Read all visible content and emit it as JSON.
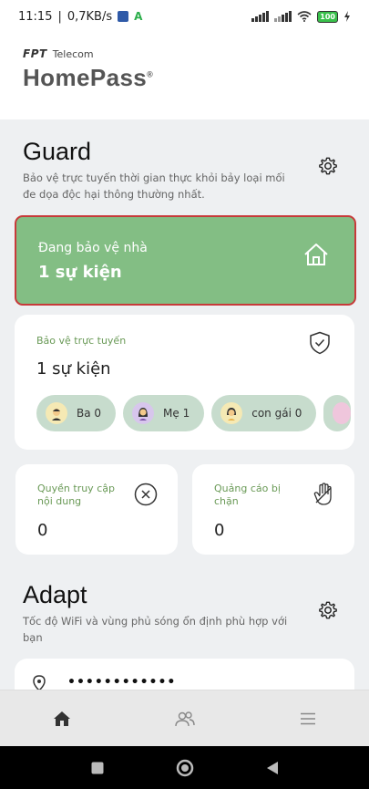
{
  "statusbar": {
    "time": "11:15",
    "speed": "0,7KB/s",
    "battery": "100"
  },
  "header": {
    "brand": "FPT",
    "brand_sub": "Telecom",
    "app_title": "HomePass",
    "trademark": "®"
  },
  "guard": {
    "title": "Guard",
    "description": "Bảo vệ trực tuyến thời gian thực khỏi bảy loại mối đe dọa độc hại thông thường nhất.",
    "protect_label": "Đang bảo vệ nhà",
    "protect_count": "1 sự kiện",
    "online_label": "Bảo vệ trực tuyến",
    "online_count": "1 sự kiện",
    "people": [
      {
        "name": "Ba 0"
      },
      {
        "name": "Mẹ 1"
      },
      {
        "name": "con gái 0"
      }
    ],
    "content_access_label": "Quyền truy cập nội dung",
    "content_access_value": "0",
    "ads_blocked_label": "Quảng cáo bị chặn",
    "ads_blocked_value": "0"
  },
  "adapt": {
    "title": "Adapt",
    "description": "Tốc độ WiFi và vùng phủ sóng ổn định phù hợp với bạn",
    "wifi_name": "••••••••••••"
  },
  "bottom_nav": [
    "home-icon",
    "people-icon",
    "menu-icon"
  ],
  "colors": {
    "protect_card": "#83be84",
    "accent_green": "#6a9a57",
    "chip_bg": "#c7dccd"
  }
}
